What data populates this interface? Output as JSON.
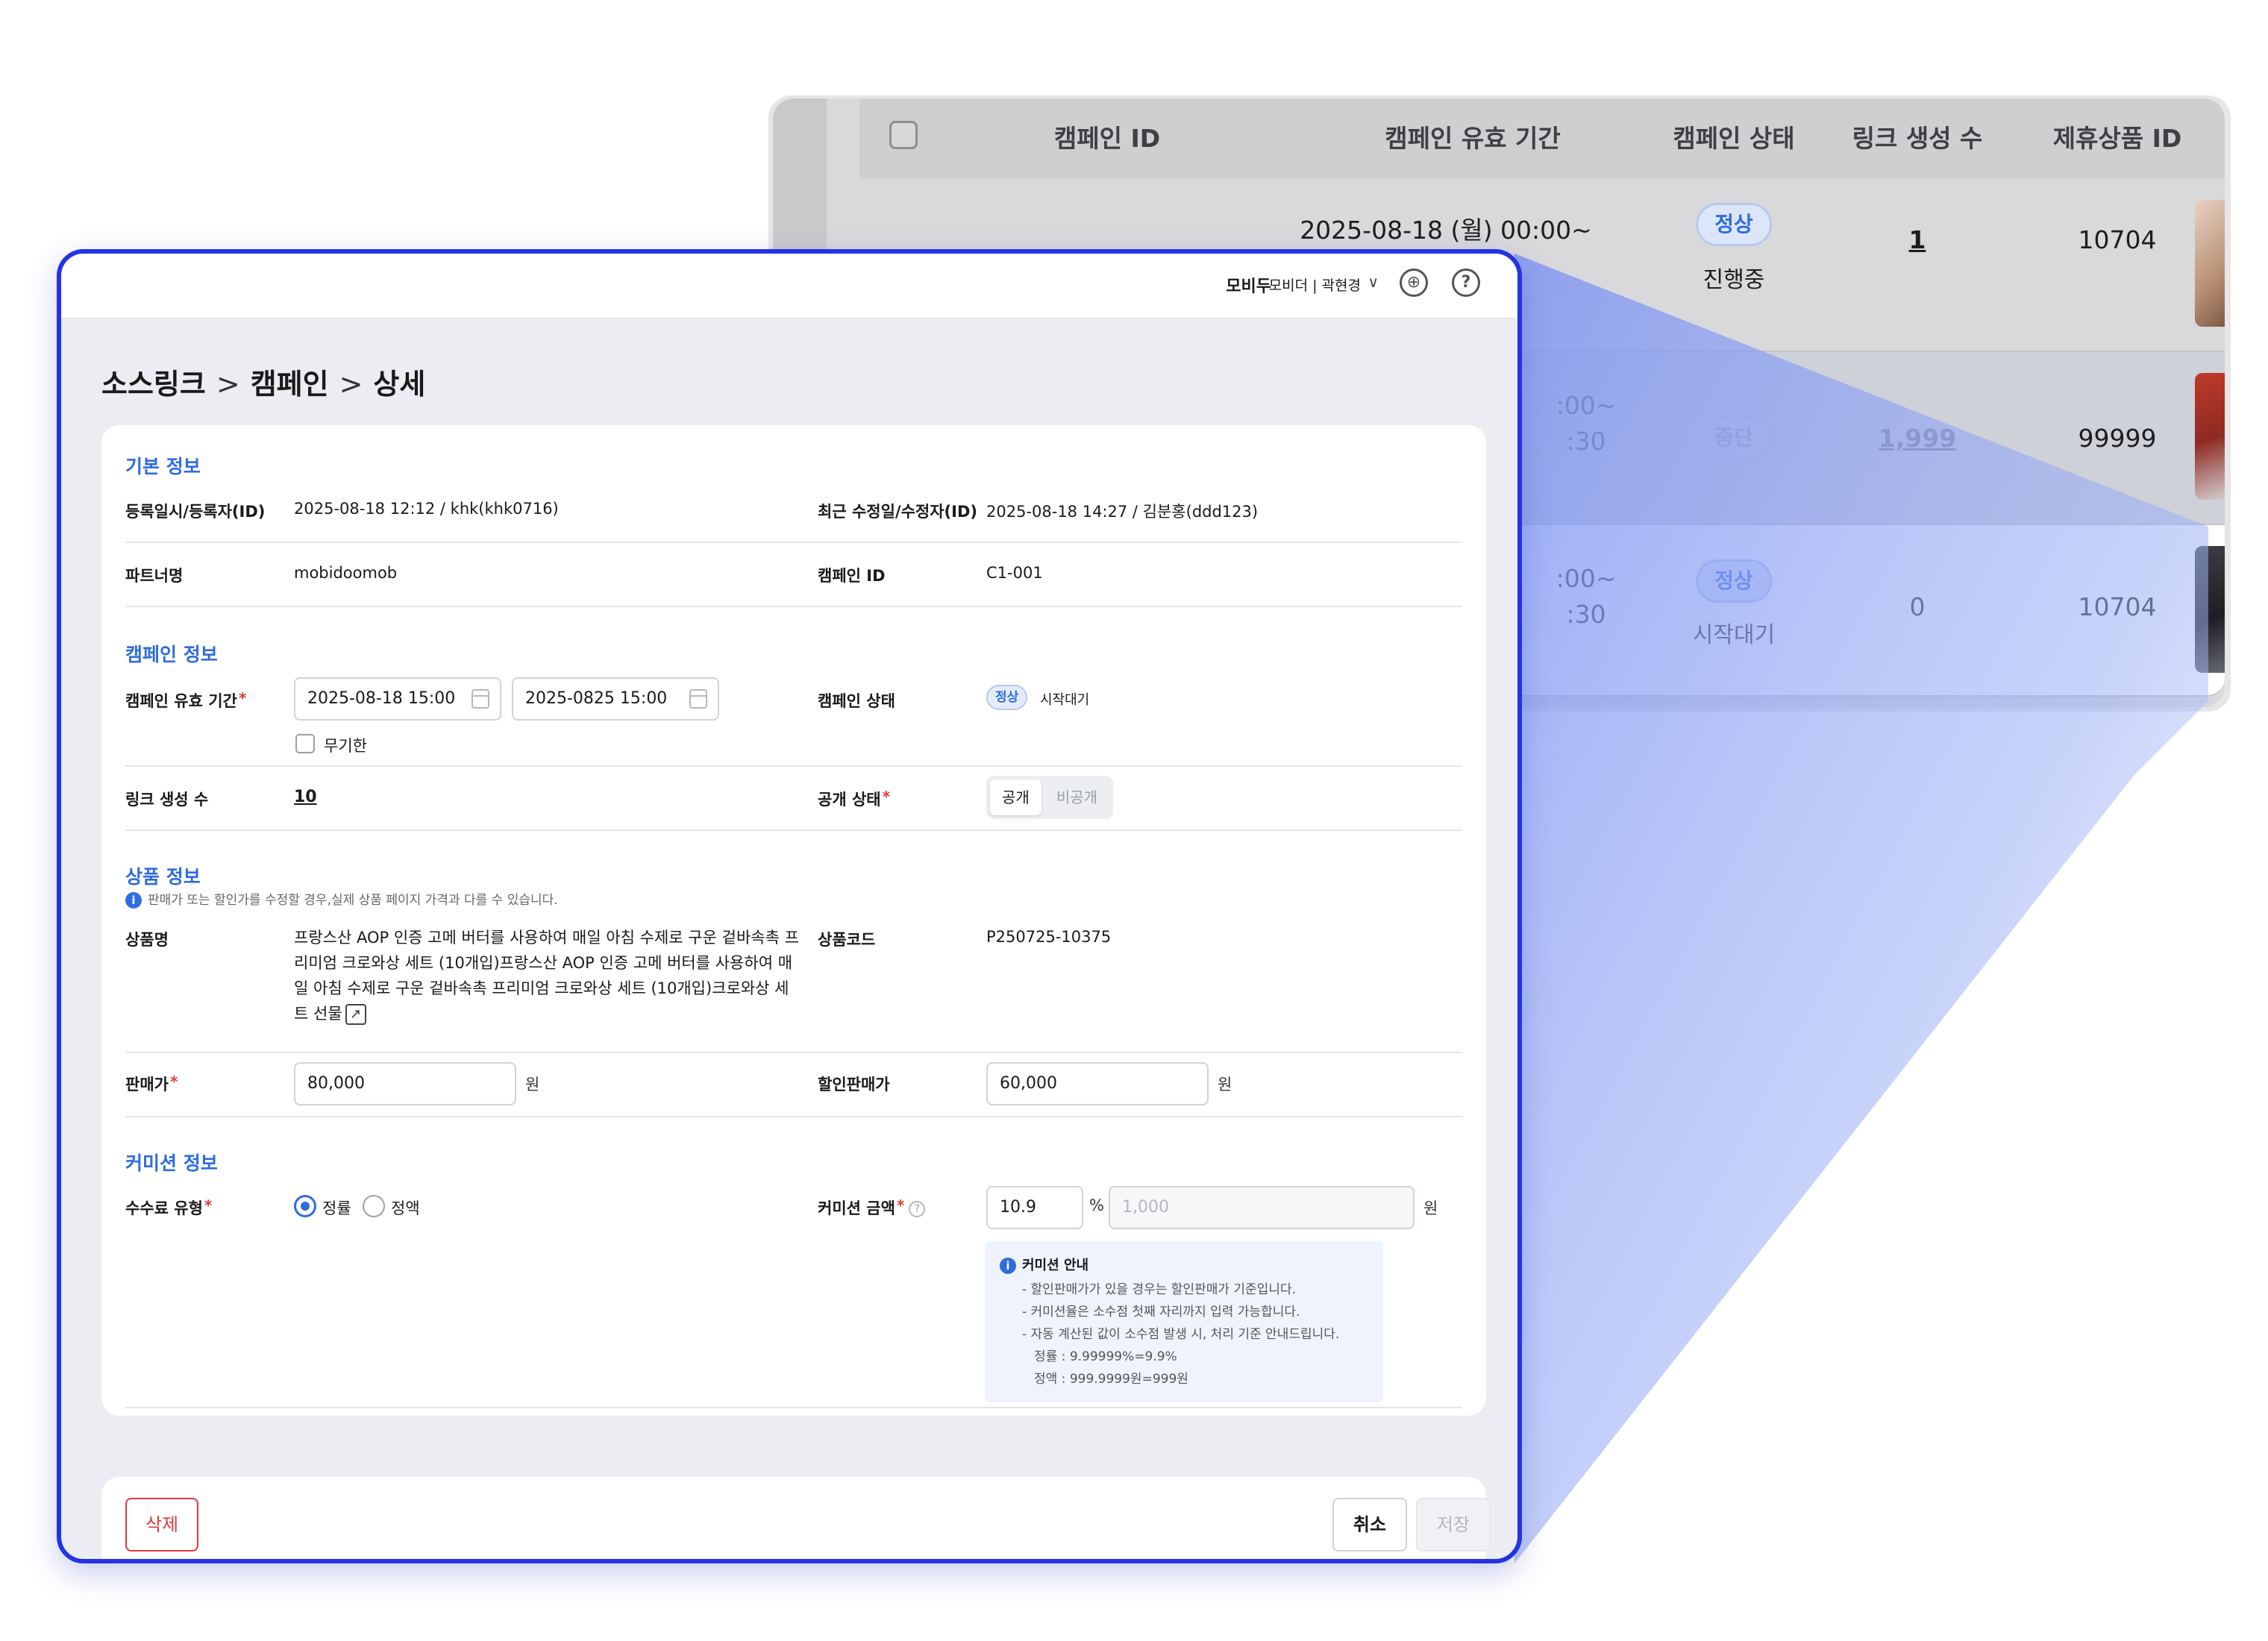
{
  "background_table": {
    "headers": [
      "캠페인 ID",
      "캠페인 유효 기간",
      "캠페인 상태",
      "링크 생성 수",
      "제휴상품 ID"
    ],
    "rows": [
      {
        "period": "2025-08-18 (월) 00:00~",
        "status": "정상",
        "status_sub": "진행중",
        "link_count": "1",
        "product_id": "10704"
      },
      {
        "period_a": ":00~",
        "period_b": ":30",
        "status": "중단",
        "link_count": "1,999",
        "product_id": "99999"
      },
      {
        "period_a": ":00~",
        "period_b": ":30",
        "status": "정상",
        "status_sub": "시작대기",
        "link_count": "0",
        "product_id": "10704"
      }
    ]
  },
  "topbar": {
    "brand": "모비두",
    "user": "모비더 | 곽현경",
    "chevron": "∨",
    "globe_icon": "globe-icon",
    "help_icon": "help-icon",
    "help_glyph": "?"
  },
  "breadcrumb": {
    "items": [
      "소스링크",
      "캠페인",
      "상세"
    ],
    "sep": ">"
  },
  "basic_info": {
    "title": "기본 정보",
    "reg_label": "등록일시/등록자(ID)",
    "reg_value": "2025-08-18 12:12 / khk(khk0716)",
    "mod_label": "최근 수정일/수정자(ID)",
    "mod_value": "2025-08-18 14:27 / 김분홍(ddd123)",
    "partner_label": "파트너명",
    "partner_value": "mobidoomob",
    "campaign_id_label": "캠페인 ID",
    "campaign_id_value": "C1-001"
  },
  "campaign_info": {
    "title": "캠페인 정보",
    "period_label": "캠페인 유효 기간",
    "period_start": "2025-08-18 15:00",
    "period_end": "2025-0825 15:00",
    "unlimited_label": "무기한",
    "status_label": "캠페인 상태",
    "status_badge": "정상",
    "status_text": "시작대기",
    "link_count_label": "링크 생성 수",
    "link_count_value": "10",
    "visibility_label": "공개 상태",
    "visibility_options": [
      "공개",
      "비공개"
    ],
    "visibility_selected": "공개",
    "required_mark": "*"
  },
  "product_info": {
    "title": "상품 정보",
    "notice": "판매가 또는 할인가를 수정할 경우,실제 상품 페이지 가격과 다를 수 있습니다.",
    "name_label": "상품명",
    "name_value": "프랑스산 AOP 인증 고메 버터를 사용하여 매일 아침 수제로 구운 겉바속촉 프리미엄 크로와상 세트 (10개입)프랑스산 AOP 인증 고메 버터를 사용하여 매일 아침 수제로 구운 겉바속촉 프리미엄 크로와상 세트 (10개입)크로와상 세트 선물",
    "code_label": "상품코드",
    "code_value": "P250725-10375",
    "price_label": "판매가",
    "price_value": "80,000",
    "price_unit": "원",
    "discount_label": "할인판매가",
    "discount_value": "60,000",
    "discount_unit": "원"
  },
  "commission_info": {
    "title": "커미션 정보",
    "type_label": "수수료 유형",
    "type_options": [
      "정률",
      "정액"
    ],
    "type_selected": "정률",
    "amount_label": "커미션 금액",
    "rate_value": "10.9",
    "rate_unit": "%",
    "amount_placeholder": "1,000",
    "amount_unit": "원",
    "guide_title": "커미션 안내",
    "guide_lines": [
      "- 할인판매가가 있을 경우는 할인판매가 기준입니다.",
      "- 커미션율은 소수점 첫째 자리까지 입력 가능합니다.",
      "- 자동 계산된 값이 소수점 발생 시, 처리 기준 안내드립니다.",
      "정률 : 9.99999%=9.9%",
      "정액 : 999.9999원=999원"
    ]
  },
  "footer": {
    "delete_label": "삭제",
    "cancel_label": "취소",
    "save_label": "저장"
  },
  "colors": {
    "accent": "#2f6ce0",
    "modal_border": "#2433e6",
    "danger": "#e5383b"
  }
}
